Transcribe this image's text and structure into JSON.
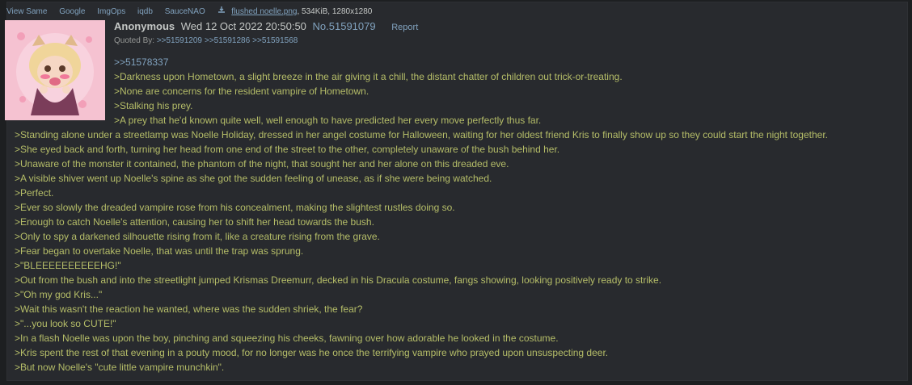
{
  "file_bar": {
    "tools": [
      "View Same",
      "Google",
      "ImgOps",
      "iqdb",
      "SauceNAO"
    ],
    "filename": "flushed noelle.png",
    "meta": ", 534KiB, 1280x1280"
  },
  "post": {
    "name": "Anonymous",
    "datetime": "Wed 12 Oct 2022 20:50:50",
    "number": "No.51591079",
    "report_label": "Report",
    "quoted_by_label": "Quoted By:",
    "backlinks": [
      ">>51591209",
      ">>51591286",
      ">>51591568"
    ],
    "quotelink": ">>51578337",
    "lines": [
      ">Darkness upon Hometown, a slight breeze in the air giving it a chill, the distant chatter of children out trick-or-treating.",
      ">None are concerns for the resident vampire of Hometown.",
      ">Stalking his prey.",
      ">A prey that he'd known quite well, well enough to have predicted her every move perfectly thus far.",
      ">Standing alone under a streetlamp was Noelle Holiday, dressed in her angel costume for Halloween, waiting for her oldest friend Kris to finally show up so they could start the night together.",
      ">She eyed back and forth, turning her head from one end of the street to the other, completely unaware of the bush behind her.",
      ">Unaware of the monster it contained, the phantom of the night, that sought her and her alone on this dreaded eve.",
      ">A visible shiver went up Noelle's spine as she got the sudden feeling of unease, as if she were being watched.",
      ">Perfect.",
      ">Ever so slowly the dreaded vampire rose from his concealment, making the slightest rustles doing so.",
      ">Enough to catch Noelle's attention, causing her to shift her head towards the bush.",
      ">Only to spy a darkened silhouette rising from it, like a creature rising from the grave.",
      ">Fear began to overtake Noelle, that was until the trap was sprung.",
      ">\"BLEEEEEEEEEEHG!\"",
      ">Out from the bush and into the streetlight jumped Krismas Dreemurr, decked in his Dracula costume, fangs showing, looking positively ready to strike.",
      ">\"Oh my god Kris...\"",
      ">Wait this wasn't the reaction he wanted, where was the sudden shriek, the fear?",
      ">\"...you look so CUTE!\"",
      ">In a flash Noelle was upon the boy, pinching and squeezing his cheeks, fawning over how adorable he looked in the costume.",
      ">Kris spent the rest of that evening in a pouty mood, for no longer was he once the terrifying vampire who prayed upon unsuspecting deer.",
      ">But now Noelle's \"cute little vampire munchkin\"."
    ]
  },
  "colors": {
    "background": "#1d1f21",
    "post_background": "#282a2e",
    "text": "#c5c8c6",
    "link": "#81a2be",
    "greentext": "#b5bd68"
  },
  "icons": {
    "download": "download-icon",
    "thumbnail": "flushed-noelle-thumbnail"
  }
}
